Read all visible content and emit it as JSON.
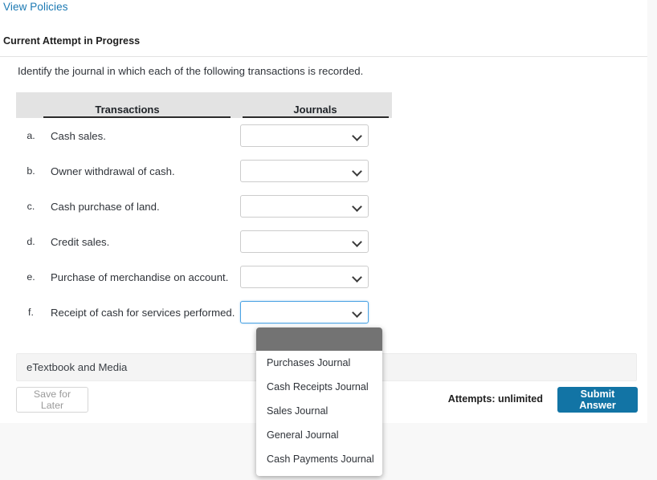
{
  "header": {
    "view_policies_label": "View Policies",
    "attempt_heading": "Current Attempt in Progress"
  },
  "question": {
    "prompt": "Identify the journal in which each of the following transactions is recorded."
  },
  "table": {
    "columns": {
      "transactions": "Transactions",
      "journals": "Journals"
    },
    "rows": [
      {
        "letter": "a.",
        "transaction": "Cash sales.",
        "value": ""
      },
      {
        "letter": "b.",
        "transaction": "Owner withdrawal of cash.",
        "value": ""
      },
      {
        "letter": "c.",
        "transaction": "Cash purchase of land.",
        "value": ""
      },
      {
        "letter": "d.",
        "transaction": "Credit sales.",
        "value": ""
      },
      {
        "letter": "e.",
        "transaction": "Purchase of merchandise on account.",
        "value": ""
      },
      {
        "letter": "f.",
        "transaction": "Receipt of cash for services performed.",
        "value": ""
      }
    ]
  },
  "dropdown": {
    "open_for_row": "f.",
    "selected_option": "",
    "options": [
      "",
      "Purchases Journal",
      "Cash Receipts Journal",
      "Sales Journal",
      "General Journal",
      "Cash Payments Journal"
    ]
  },
  "footer": {
    "etextbook_label": "eTextbook and Media",
    "save_for_later_label": "Save for Later",
    "attempts_label": "Attempts: unlimited",
    "submit_label": "Submit Answer"
  },
  "colors": {
    "link": "#1b79b3",
    "submit_button": "#1274a5",
    "table_header_bg": "#e3e3e3",
    "dropdown_highlight": "#737373",
    "focus_border": "#4ba3e3",
    "page_bg": "#f8f8f8"
  }
}
